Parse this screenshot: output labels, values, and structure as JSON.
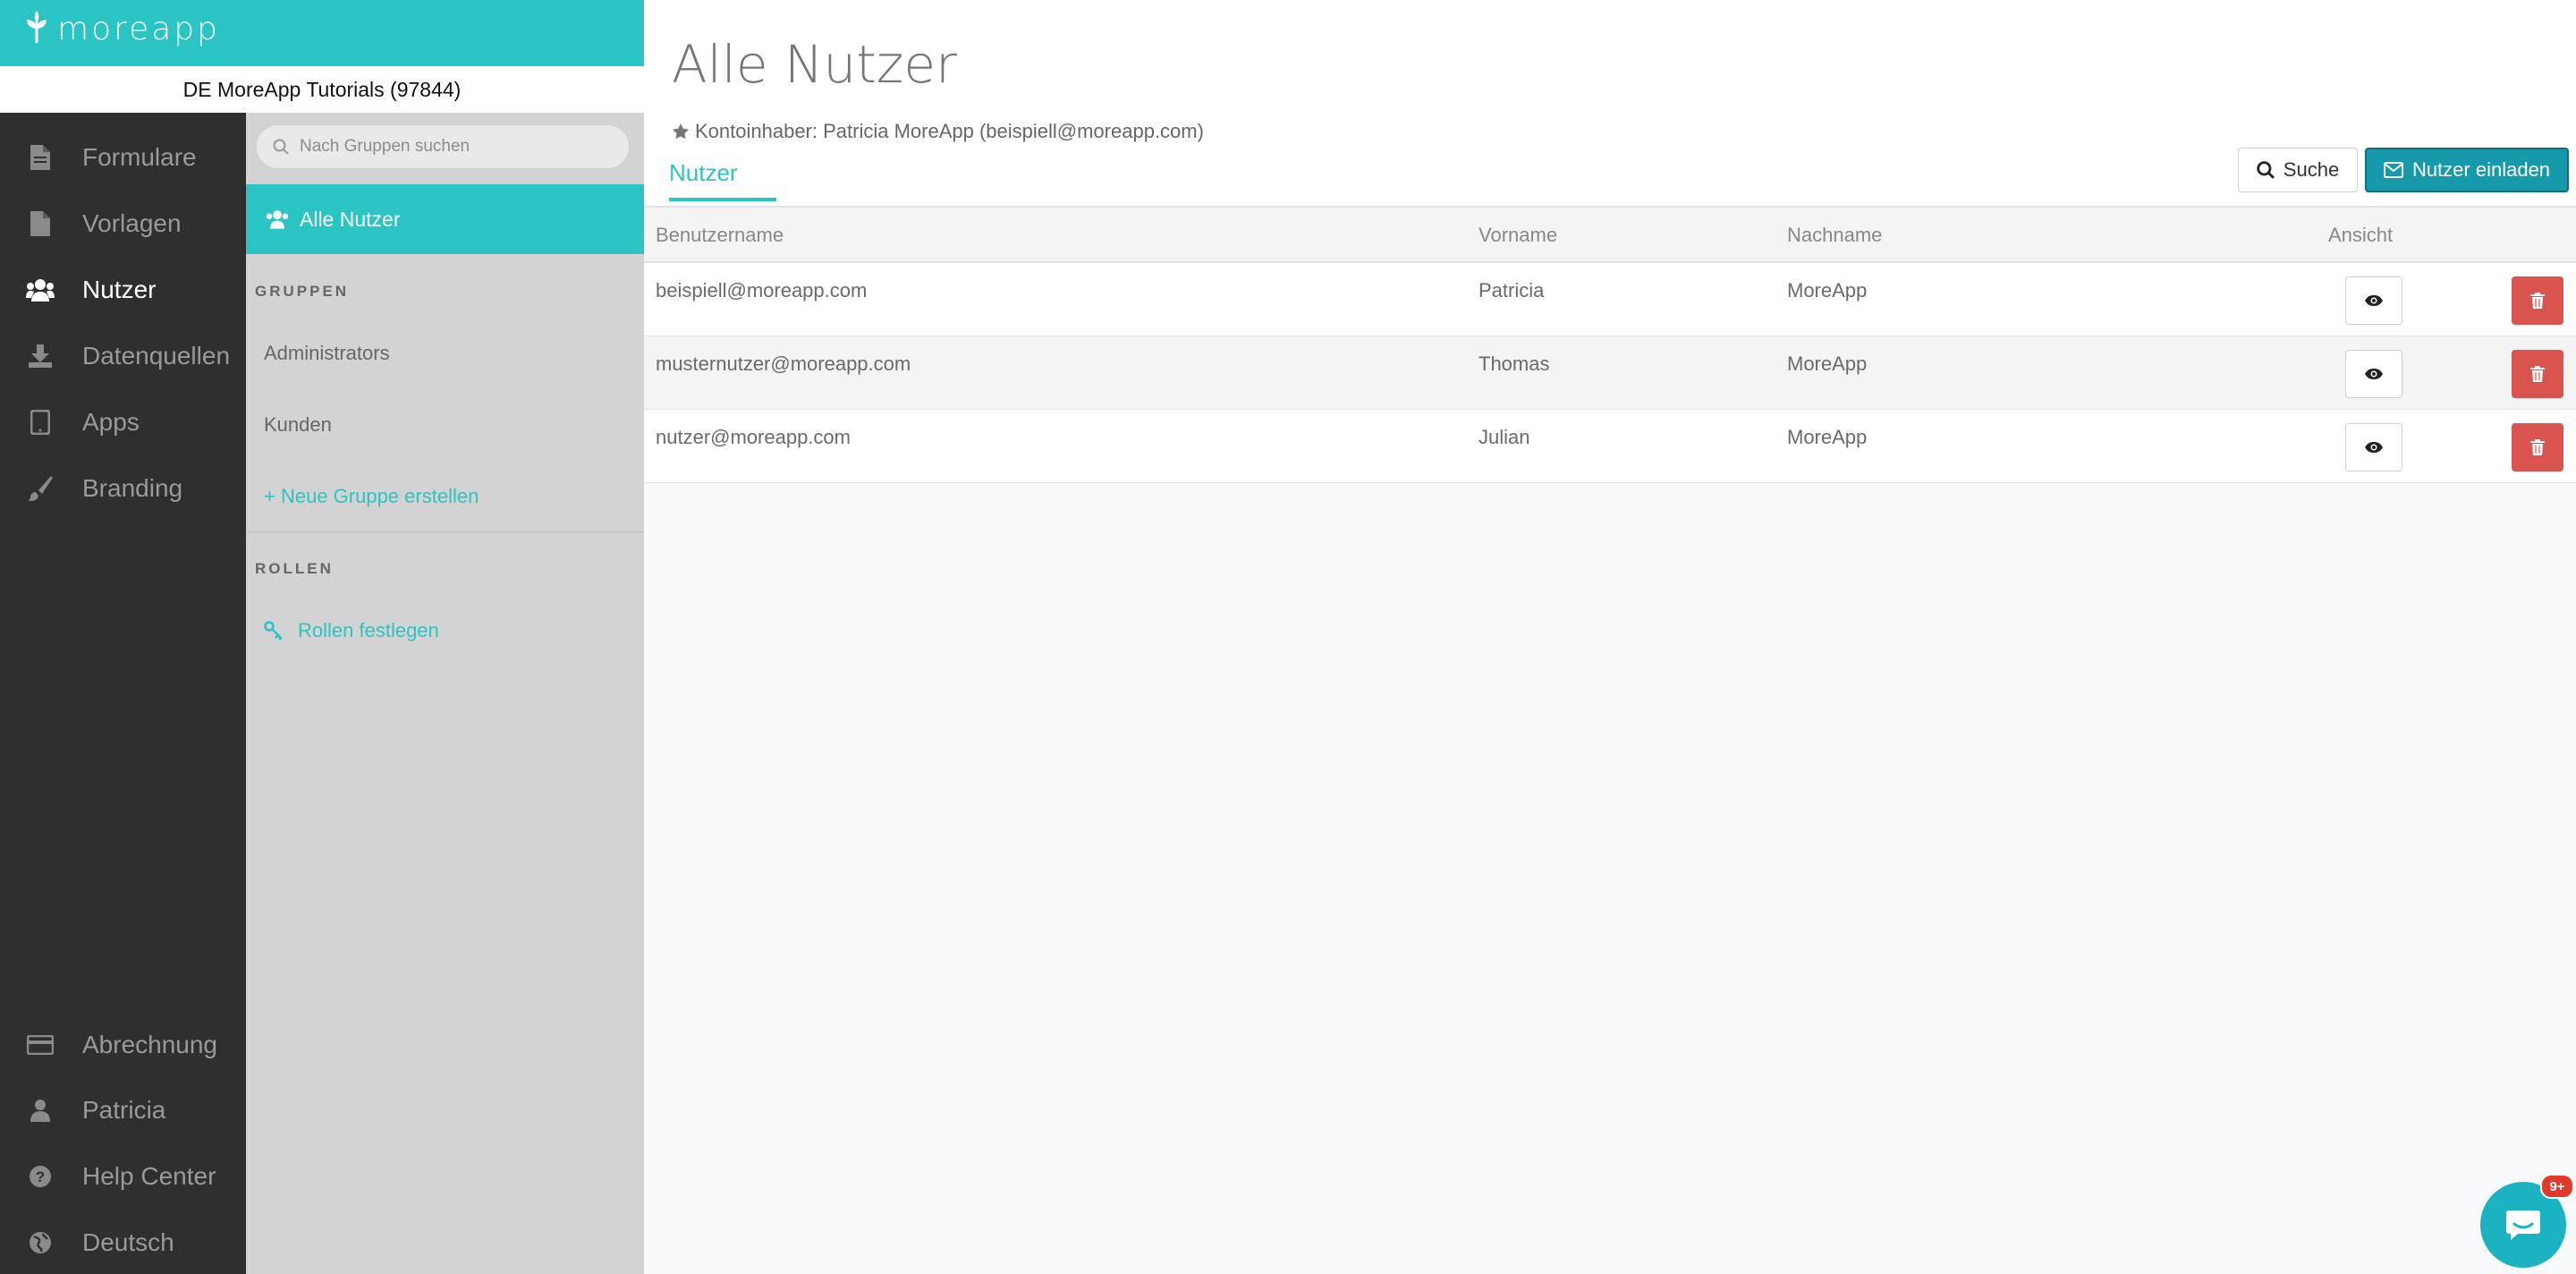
{
  "app": {
    "brand": "moreapp",
    "account": "DE MoreApp Tutorials (97844)"
  },
  "nav": {
    "items": [
      {
        "label": "Formulare",
        "icon": "file-icon"
      },
      {
        "label": "Vorlagen",
        "icon": "template-icon"
      },
      {
        "label": "Nutzer",
        "icon": "users-icon",
        "active": true
      },
      {
        "label": "Datenquellen",
        "icon": "download-icon"
      },
      {
        "label": "Apps",
        "icon": "tablet-icon"
      },
      {
        "label": "Branding",
        "icon": "brush-icon"
      }
    ],
    "bottom": [
      {
        "label": "Abrechnung",
        "icon": "credit-card-icon"
      },
      {
        "label": "Patricia",
        "icon": "user-icon"
      },
      {
        "label": "Help Center",
        "icon": "question-icon"
      },
      {
        "label": "Deutsch",
        "icon": "globe-icon"
      }
    ]
  },
  "groups": {
    "search_placeholder": "Nach Gruppen suchen",
    "all_users": "Alle Nutzer",
    "groups_heading": "GRUPPEN",
    "items": [
      "Administrators",
      "Kunden"
    ],
    "new_group": "+ Neue Gruppe erstellen",
    "roles_heading": "ROLLEN",
    "set_roles": "Rollen festlegen"
  },
  "main": {
    "title": "Alle Nutzer",
    "owner": "Kontoinhaber: Patricia MoreApp (beispiell@moreapp.com)",
    "tab": "Nutzer",
    "search_button": "Suche",
    "invite_button": "Nutzer einladen",
    "columns": {
      "username": "Benutzername",
      "firstname": "Vorname",
      "lastname": "Nachname",
      "view": "Ansicht"
    },
    "rows": [
      {
        "username": "beispiell@moreapp.com",
        "firstname": "Patricia",
        "lastname": "MoreApp"
      },
      {
        "username": "musternutzer@moreapp.com",
        "firstname": "Thomas",
        "lastname": "MoreApp"
      },
      {
        "username": "nutzer@moreapp.com",
        "firstname": "Julian",
        "lastname": "MoreApp"
      }
    ]
  },
  "chat": {
    "badge": "9+"
  },
  "colors": {
    "accent": "#2bc4c4",
    "invite": "#169aab",
    "delete": "#d9534f",
    "sidebar": "#2f2f2f"
  }
}
